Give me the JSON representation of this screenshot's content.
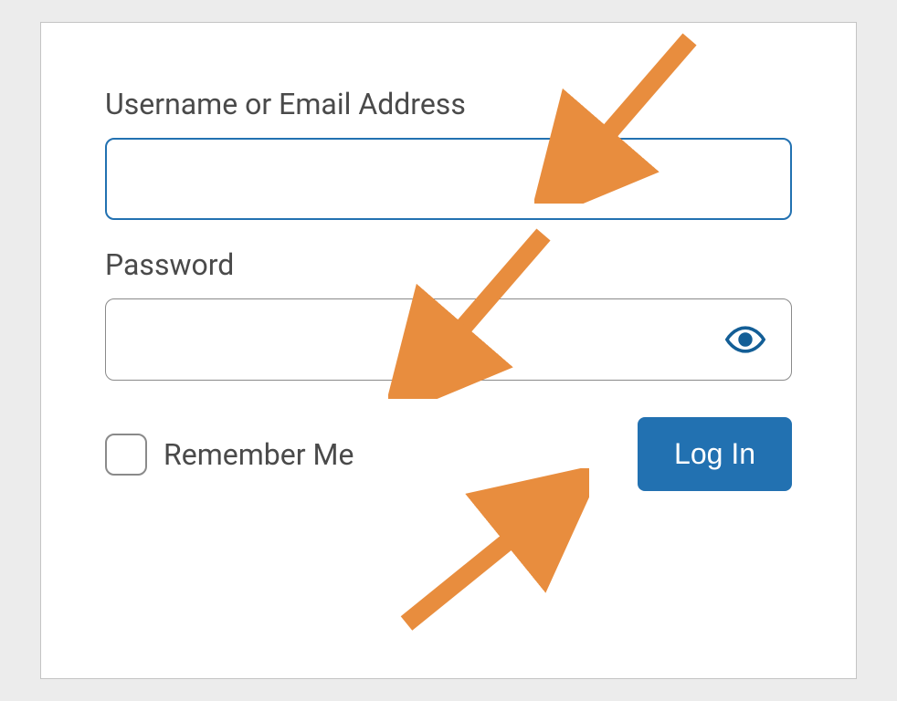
{
  "login": {
    "username_label": "Username or Email Address",
    "password_label": "Password",
    "remember_label": "Remember Me",
    "login_button_label": "Log In",
    "username_value": "",
    "password_value": ""
  },
  "colors": {
    "accent": "#2271b1",
    "arrow": "#e88d3e"
  }
}
